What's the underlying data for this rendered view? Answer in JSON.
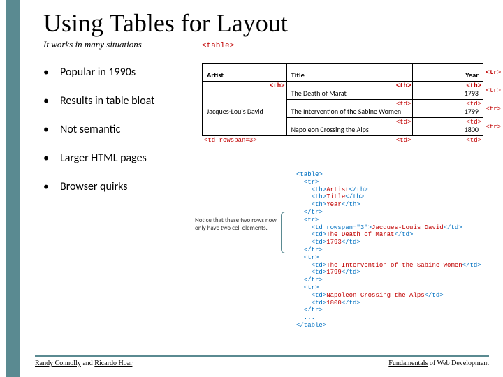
{
  "title": "Using Tables for Layout",
  "subtitle": "It works in many situations",
  "bullets": [
    "Popular in 1990s",
    "Results in table bloat",
    "Not semantic",
    "Larger HTML pages",
    "Browser quirks"
  ],
  "table_tag": "<table>",
  "headers": {
    "artist": "Artist",
    "title": "Title",
    "year": "Year"
  },
  "rows": [
    {
      "artist": "Jacques-Louis David",
      "title": "The Death of Marat",
      "year": "1793"
    },
    {
      "title": "The Intervention of the Sabine Women",
      "year": "1799"
    },
    {
      "title": "Napoleon Crossing the Alps",
      "year": "1800"
    }
  ],
  "tags": {
    "th": "<th>",
    "td": "<td>",
    "tr": "<tr>",
    "rowspan": "<td rowspan=3>"
  },
  "code_lines": [
    [
      "<table>",
      ""
    ],
    [
      "  <tr>",
      ""
    ],
    [
      "    <th>",
      "Artist",
      "</th>"
    ],
    [
      "    <th>",
      "Title",
      "</th>"
    ],
    [
      "    <th>",
      "Year",
      "</th>"
    ],
    [
      "  </tr>",
      ""
    ],
    [
      "  <tr>",
      ""
    ],
    [
      "    <td rowspan=\"3\">",
      "Jacques-Louis David",
      "</td>"
    ],
    [
      "    <td>",
      "The Death of Marat",
      "</td>"
    ],
    [
      "    <td>",
      "1793",
      "</td>"
    ],
    [
      "  </tr>",
      ""
    ],
    [
      "  <tr>",
      ""
    ],
    [
      "    <td>",
      "The Intervention of the Sabine Women",
      "</td>"
    ],
    [
      "    <td>",
      "1799",
      "</td>"
    ],
    [
      "  </tr>",
      ""
    ],
    [
      "  <tr>",
      ""
    ],
    [
      "    <td>",
      "Napoleon Crossing the Alps",
      "</td>"
    ],
    [
      "    <td>",
      "1800",
      "</td>"
    ],
    [
      "  </tr>",
      ""
    ],
    [
      "  ...",
      ""
    ],
    [
      "</table>",
      ""
    ]
  ],
  "note": "Notice that these two rows now only have two cell elements.",
  "footer": {
    "left_parts": [
      "Randy Connolly",
      " and ",
      "Ricardo Hoar"
    ],
    "right_parts": [
      "Fundamentals",
      " of Web Development"
    ]
  }
}
